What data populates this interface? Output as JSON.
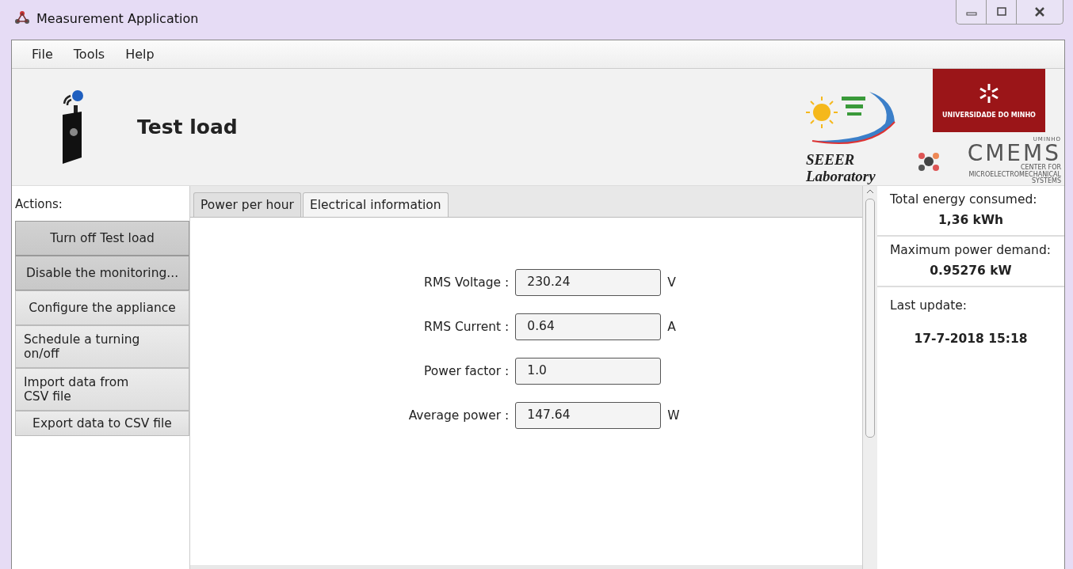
{
  "window": {
    "title": "Measurement Application"
  },
  "menu": [
    "File",
    "Tools",
    "Help"
  ],
  "header": {
    "device_name": "Test load",
    "lab_name": "SEEER Laboratory",
    "university": "UNIVERSIDADE DO MINHO",
    "cmems_top": "UMINHO",
    "cmems_name": "CMEMS",
    "cmems_sub": "CENTER FOR MICROELECTROMECHANICAL SYSTEMS"
  },
  "actions": {
    "label": "Actions:",
    "buttons": [
      {
        "label": "Turn off Test load",
        "pressed": true
      },
      {
        "label": "Disable the monitoring...",
        "pressed": true
      },
      {
        "label": "Configure the appliance",
        "pressed": false
      },
      {
        "label": "Schedule a turning on/off",
        "pressed": false
      },
      {
        "label": "Import data from CSV file",
        "pressed": false
      },
      {
        "label": "Export data to CSV file",
        "pressed": false
      }
    ]
  },
  "tabs": [
    {
      "label": "Power per hour",
      "selected": false
    },
    {
      "label": "Electrical information",
      "selected": true
    }
  ],
  "fields": [
    {
      "label": "RMS Voltage :",
      "value": "230.24",
      "unit": "V"
    },
    {
      "label": "RMS Current :",
      "value": "0.64",
      "unit": "A"
    },
    {
      "label": "Power factor :",
      "value": "1.0"
    },
    {
      "label": "Average power :",
      "value": "147.64",
      "unit": "W"
    }
  ],
  "summary": [
    {
      "label": "Total energy consumed:",
      "value": "1,36 kWh"
    },
    {
      "label": "Maximum power demand:",
      "value": "0.95276 kW"
    },
    {
      "label": "Last update:",
      "value": "17-7-2018 15:18"
    }
  ]
}
